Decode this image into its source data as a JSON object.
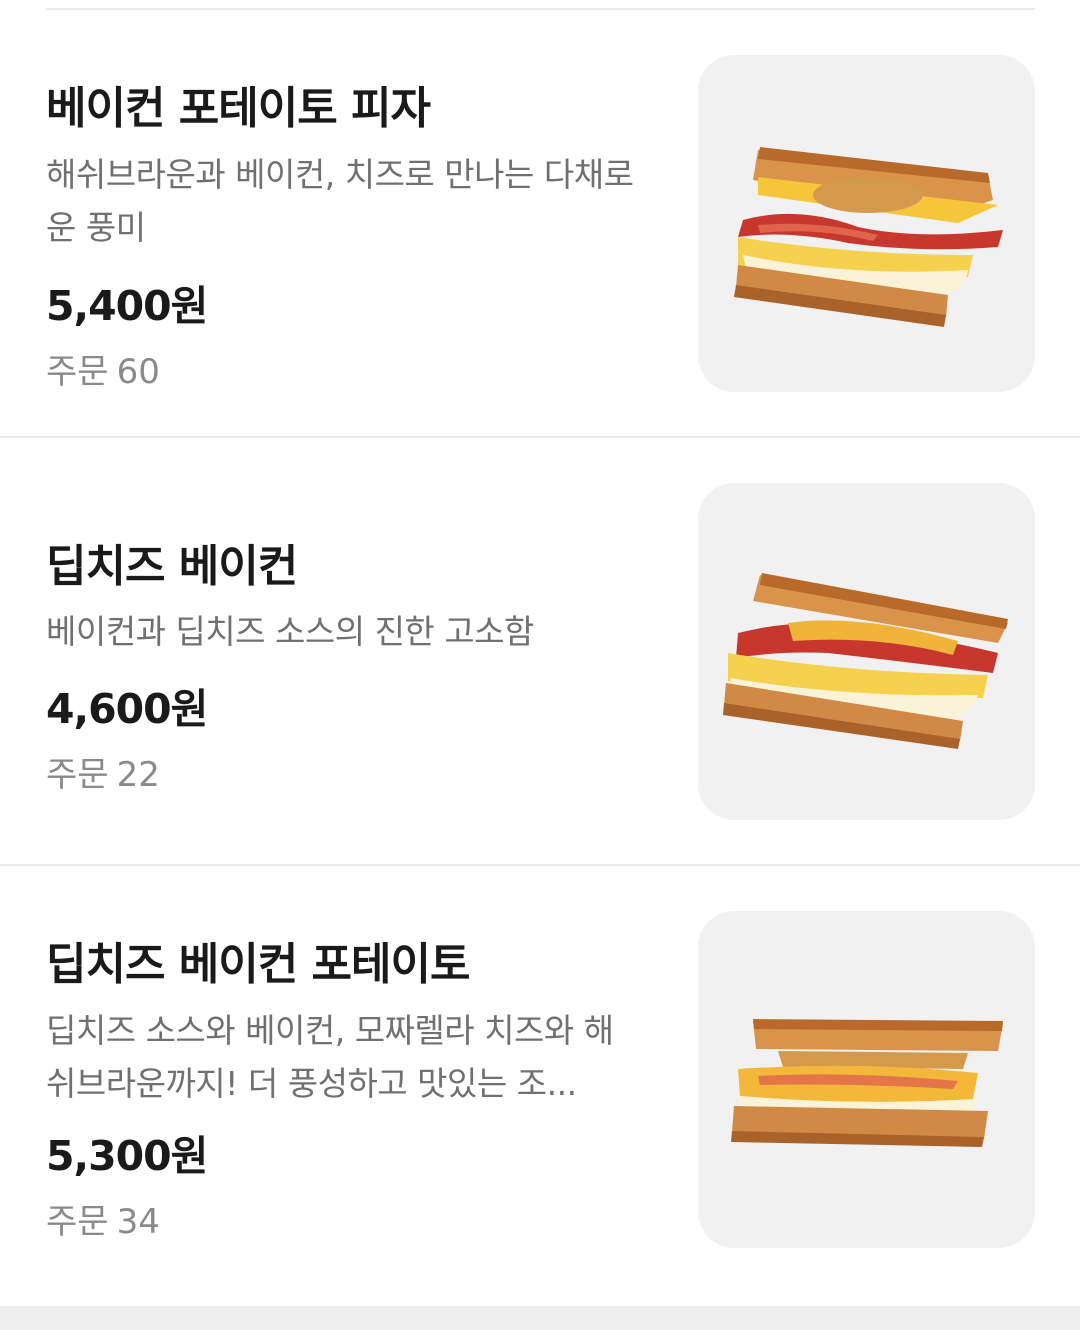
{
  "menu": {
    "items": [
      {
        "name": "베이컨 포테이토 피자",
        "description": "해쉬브라운과 베이컨, 치즈로 만나는 다채로운 풍미",
        "price": "5,400원",
        "orders_label": "주문",
        "orders_count": "60",
        "image_icon": "sandwich-bacon-potato-pizza-photo"
      },
      {
        "name": "딥치즈 베이컨",
        "description": "베이컨과 딥치즈 소스의 진한 고소함",
        "price": "4,600원",
        "orders_label": "주문",
        "orders_count": "22",
        "image_icon": "sandwich-deep-cheese-bacon-photo"
      },
      {
        "name": "딥치즈 베이컨 포테이토",
        "description": "딥치즈 소스와 베이컨, 모짜렐라 치즈와 해쉬브라운까지! 더 풍성하고 맛있는 조...",
        "price": "5,300원",
        "orders_label": "주문",
        "orders_count": "34",
        "image_icon": "sandwich-deep-cheese-bacon-potato-photo"
      }
    ]
  },
  "colors": {
    "text_primary": "#1a1a1a",
    "text_secondary": "#707070",
    "text_muted": "#8a8a8a",
    "thumb_bg": "#f1f1f1",
    "divider": "#ececec"
  }
}
